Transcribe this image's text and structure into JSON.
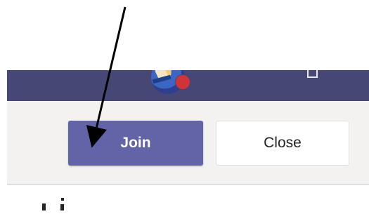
{
  "actions": {
    "join_label": "Join",
    "close_label": "Close"
  },
  "colors": {
    "header": "#464775",
    "join_button": "#6264a7",
    "presence": "#d13438",
    "action_bar": "#f3f2f1"
  },
  "icons": {
    "avatar": "user-avatar",
    "presence": "presence-busy-icon",
    "annotation": "arrow-annotation"
  }
}
